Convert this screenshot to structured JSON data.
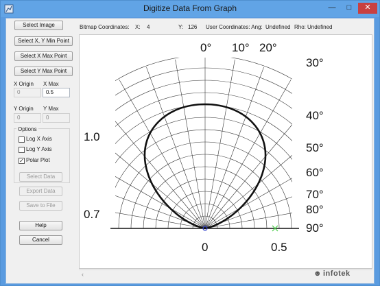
{
  "window": {
    "title": "Digitize Data From Graph"
  },
  "controls": {
    "select_image": "Select Image",
    "select_xy_min": "Select X, Y Min Point",
    "select_x_max": "Select X Max Point",
    "select_y_max": "Select Y Max Point",
    "x_origin_label": "X Origin",
    "x_max_label": "X Max",
    "x_origin_value": "0",
    "x_max_value": "0.5",
    "y_origin_label": "Y Origin",
    "y_max_label": "Y Max",
    "y_origin_value": "0",
    "y_max_value": "0",
    "options_label": "Options",
    "options": [
      {
        "label": "Log X Axis",
        "checked": false
      },
      {
        "label": "Log Y Axis",
        "checked": false
      },
      {
        "label": "Polar Plot",
        "checked": true
      }
    ],
    "select_data": "Select Data",
    "export_data": "Export Data",
    "save_to_file": "Save to File",
    "help": "Help",
    "cancel": "Cancel"
  },
  "status": {
    "bitmap_label": "Bitmap Coordinates:",
    "x_label": "X:",
    "x_value": "4",
    "y_label": "Y:",
    "y_value": "126",
    "user_label": "User Coordinates: Ang:",
    "ang_value": "Undefined",
    "rho_label": "Rho:",
    "rho_value": "Undefined"
  },
  "graph": {
    "top_angle_labels": [
      "0°",
      "10°",
      "20°"
    ],
    "right_angle_labels": [
      "30°",
      "40°",
      "50°",
      "60°",
      "70°",
      "80°",
      "90°"
    ],
    "left_rho_labels": [
      "1.0",
      "0.7"
    ],
    "bottom_labels": [
      "0",
      "0.5"
    ]
  },
  "watermark": "infotek"
}
